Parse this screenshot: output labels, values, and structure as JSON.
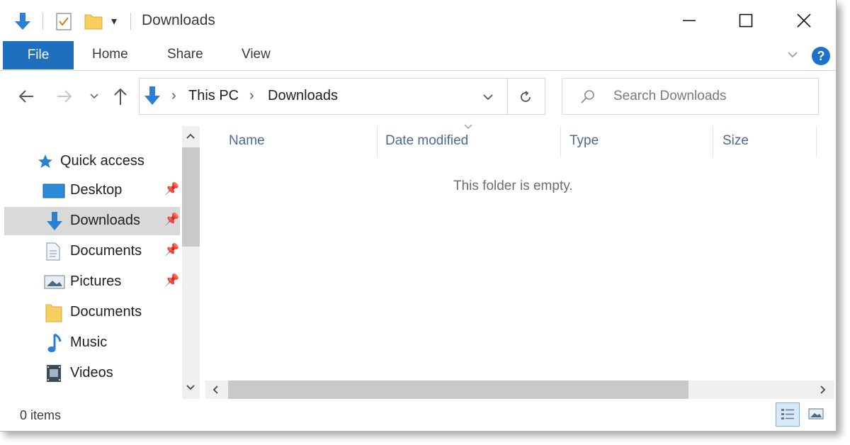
{
  "window": {
    "title": "Downloads"
  },
  "ribbon": {
    "tabs": [
      "File",
      "Home",
      "Share",
      "View"
    ],
    "help_label": "?"
  },
  "address": {
    "breadcrumbs": [
      "This PC",
      "Downloads"
    ]
  },
  "search": {
    "placeholder": "Search Downloads"
  },
  "nav_pane": {
    "quick_access": "Quick access",
    "items": [
      {
        "label": "Desktop",
        "icon": "desktop-icon",
        "pinned": true
      },
      {
        "label": "Downloads",
        "icon": "download-arrow-icon",
        "pinned": true,
        "selected": true
      },
      {
        "label": "Documents",
        "icon": "document-icon",
        "pinned": true
      },
      {
        "label": "Pictures",
        "icon": "pictures-icon",
        "pinned": true
      },
      {
        "label": "Documents",
        "icon": "folder-icon",
        "pinned": false
      },
      {
        "label": "Music",
        "icon": "music-icon",
        "pinned": false
      },
      {
        "label": "Videos",
        "icon": "videos-icon",
        "pinned": false
      }
    ]
  },
  "content": {
    "columns": [
      "Name",
      "Date modified",
      "Type",
      "Size"
    ],
    "empty_message": "This folder is empty."
  },
  "status_bar": {
    "item_count": "0 items"
  },
  "colors": {
    "accent": "#1e6fbe",
    "selected_bg": "#d9d9d9",
    "header_text": "#4d6a8c"
  }
}
